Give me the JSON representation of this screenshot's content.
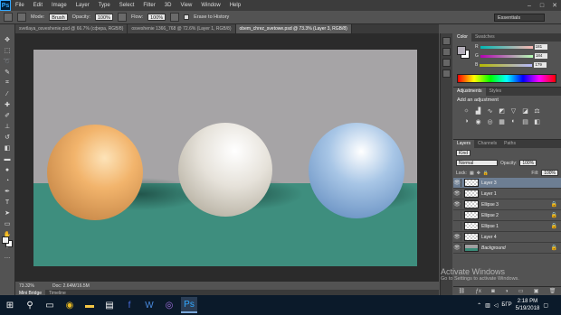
{
  "app": {
    "logo": "Ps"
  },
  "menu": [
    "File",
    "Edit",
    "Image",
    "Layer",
    "Type",
    "Select",
    "Filter",
    "3D",
    "View",
    "Window",
    "Help"
  ],
  "window_controls": {
    "minimize": "–",
    "maximize": "□",
    "close": "✕"
  },
  "options_bar": {
    "mode_label": "Mode:",
    "mode_value": "Brush",
    "opacity_label": "Opacity:",
    "opacity_value": "100%",
    "flow_label": "Flow:",
    "flow_value": "100%",
    "erase_label": "Erase to History",
    "workspace": "Essentials"
  },
  "doc_tabs": [
    "svetlaya_osveshenie.psd @ 66.7% (сфера, RGB/8)",
    "osveshenie 1366_768 @ 72.6% (Layer 1, RGB/8)",
    "obem_chrez_svetowe.psd @ 73.3% (Layer 3, RGB/8)"
  ],
  "status": {
    "zoom": "73.32%",
    "doc": "Doc: 2.64M/16.5M"
  },
  "bottom_tabs": [
    "Mini Bridge",
    "Timeline"
  ],
  "color_panel": {
    "tabs": [
      "Color",
      "Swatches"
    ],
    "fg_color": "#b5b0bb",
    "r_label": "R",
    "r_value": "181",
    "g_label": "G",
    "g_value": "184",
    "b_label": "B",
    "b_value": "179"
  },
  "adjustments_panel": {
    "tabs": [
      "Adjustments",
      "Styles"
    ],
    "title": "Add an adjustment"
  },
  "layers_panel": {
    "tabs": [
      "Layers",
      "Channels",
      "Paths"
    ],
    "kind_label": "Kind",
    "blend_mode": "Normal",
    "opacity_label": "Opacity:",
    "opacity_value": "100%",
    "lock_label": "Lock:",
    "fill_label": "Fill:",
    "fill_value": "100%",
    "layers": [
      {
        "name": "Layer 3",
        "selected": true,
        "locked": false
      },
      {
        "name": "Layer 1",
        "selected": false,
        "locked": false
      },
      {
        "name": "Ellipse 3",
        "selected": false,
        "locked": true
      },
      {
        "name": "Ellipse 2",
        "selected": false,
        "locked": true
      },
      {
        "name": "Ellipse 1",
        "selected": false,
        "locked": true
      },
      {
        "name": "Layer 4",
        "selected": false,
        "locked": false
      },
      {
        "name": "Background",
        "selected": false,
        "locked": true
      }
    ]
  },
  "watermark": {
    "line1": "Activate Windows",
    "line2": "Go to Settings to activate Windows."
  },
  "taskbar": {
    "time": "2:18 PM",
    "date": "5/19/2018",
    "lang": "БГР"
  },
  "colors": {
    "wall": "#a6a4a6",
    "floor": "#3e8e7e",
    "sphere_orange": "#f2b46c",
    "sphere_white": "#e6e2da",
    "sphere_blue": "#a8c6e6"
  }
}
